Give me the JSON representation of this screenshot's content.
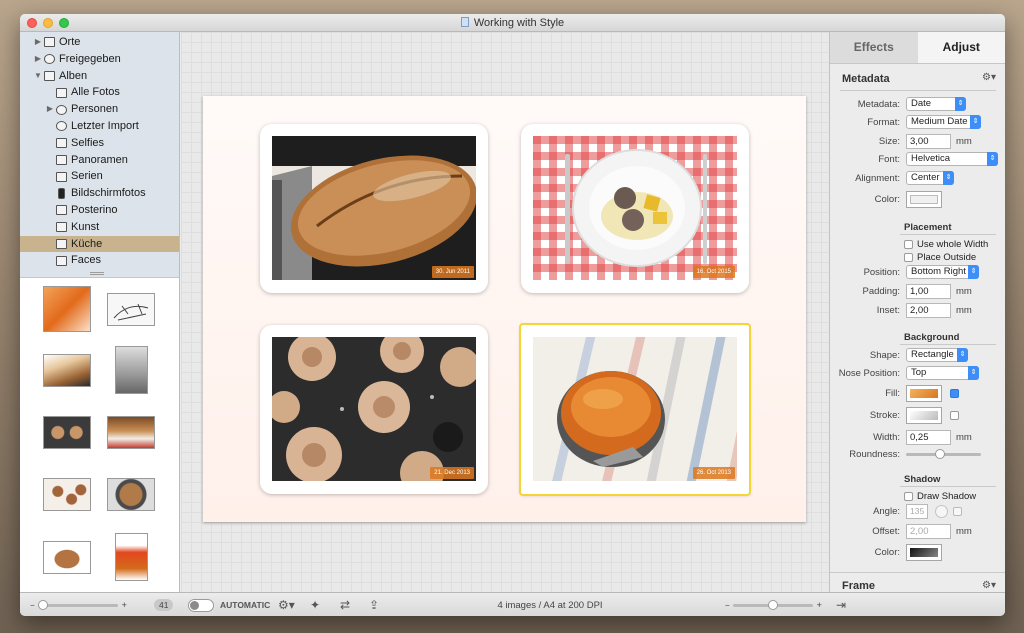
{
  "window": {
    "title": "Working with Style"
  },
  "sidebar": {
    "items": [
      {
        "label": "Orte",
        "disclosure": "▶",
        "icon": "folder-icon"
      },
      {
        "label": "Freigegeben",
        "disclosure": "▶",
        "icon": "cloud-icon"
      },
      {
        "label": "Alben",
        "disclosure": "▼",
        "icon": "folder-icon"
      },
      {
        "label": "Alle Fotos",
        "disclosure": "",
        "icon": "album-icon"
      },
      {
        "label": "Personen",
        "disclosure": "▶",
        "icon": "person-icon"
      },
      {
        "label": "Letzter Import",
        "disclosure": "",
        "icon": "clock-icon"
      },
      {
        "label": "Selfies",
        "disclosure": "",
        "icon": "camera-icon"
      },
      {
        "label": "Panoramen",
        "disclosure": "",
        "icon": "panorama-icon"
      },
      {
        "label": "Serien",
        "disclosure": "",
        "icon": "album-icon"
      },
      {
        "label": "Bildschirmfotos",
        "disclosure": "",
        "icon": "phone-icon"
      },
      {
        "label": "Posterino",
        "disclosure": "",
        "icon": "album-icon"
      },
      {
        "label": "Kunst",
        "disclosure": "",
        "icon": "album-icon"
      },
      {
        "label": "Küche",
        "disclosure": "",
        "icon": "album-icon",
        "selected": true
      },
      {
        "label": "Faces",
        "disclosure": "",
        "icon": "album-icon"
      }
    ]
  },
  "canvas": {
    "cards": [
      {
        "stamp": "30. Jun 2011",
        "subject": "bread",
        "selected": false
      },
      {
        "stamp": "16. Oct 2015",
        "subject": "plate",
        "selected": false
      },
      {
        "stamp": "21. Dec 2013",
        "subject": "buns",
        "selected": false
      },
      {
        "stamp": "26. Oct 2013",
        "subject": "cake",
        "selected": true
      }
    ]
  },
  "inspector": {
    "tabs": [
      {
        "label": "Effects",
        "active": false
      },
      {
        "label": "Adjust",
        "active": true
      }
    ],
    "metadata": {
      "header": "Metadata",
      "metadata_label": "Metadata:",
      "metadata_value": "Date",
      "format_label": "Format:",
      "format_value": "Medium Date",
      "size_label": "Size:",
      "size_value": "3,00",
      "size_unit": "mm",
      "font_label": "Font:",
      "font_value": "Helvetica",
      "alignment_label": "Alignment:",
      "alignment_value": "Center",
      "color_label": "Color:"
    },
    "placement": {
      "header": "Placement",
      "whole_width_label": "Use whole Width",
      "outside_label": "Place Outside",
      "position_label": "Position:",
      "position_value": "Bottom Right",
      "padding_label": "Padding:",
      "padding_value": "1,00",
      "padding_unit": "mm",
      "inset_label": "Inset:",
      "inset_value": "2,00",
      "inset_unit": "mm"
    },
    "background": {
      "header": "Background",
      "shape_label": "Shape:",
      "shape_value": "Rectangle",
      "nose_label": "Nose Position:",
      "nose_value": "Top",
      "fill_label": "Fill:",
      "fill_color": "#e8952e",
      "fill_checked": true,
      "stroke_label": "Stroke:",
      "stroke_checked": false,
      "width_label": "Width:",
      "width_value": "0,25",
      "width_unit": "mm",
      "roundness_label": "Roundness:",
      "roundness_level": 0.45
    },
    "shadow": {
      "header": "Shadow",
      "draw_label": "Draw Shadow",
      "angle_label": "Angle:",
      "angle_value": "135",
      "offset_label": "Offset:",
      "offset_value": "2,00",
      "offset_unit": "mm",
      "color_label": "Color:"
    },
    "frame": {
      "header": "Frame"
    }
  },
  "bottombar": {
    "thumb_count": "41",
    "automatic_label": "AUTOMATIC",
    "status": "4 images / A4 at 200 DPI",
    "zoom_level": 0.5
  }
}
